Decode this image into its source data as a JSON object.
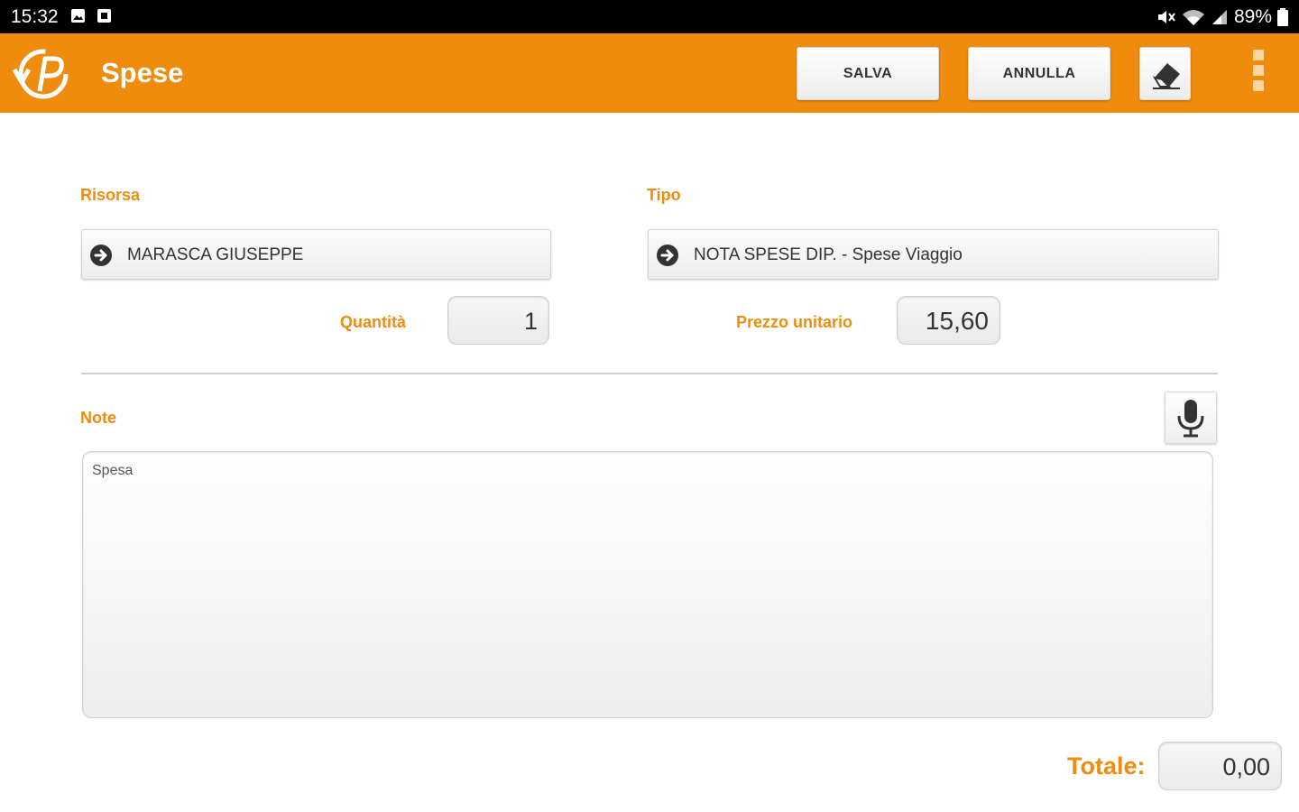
{
  "status_bar": {
    "time": "15:32",
    "battery": "89%"
  },
  "app_bar": {
    "title": "Spese",
    "save_label": "SALVA",
    "cancel_label": "ANNULLA",
    "accent_color": "#ef8c0e"
  },
  "form": {
    "risorsa_label": "Risorsa",
    "risorsa_value": "MARASCA GIUSEPPE",
    "tipo_label": "Tipo",
    "tipo_value": "NOTA SPESE DIP. - Spese Viaggio",
    "quantita_label": "Quantità",
    "quantita_value": "1",
    "prezzo_label": "Prezzo unitario",
    "prezzo_value": "15,60",
    "note_label": "Note",
    "note_value": "Spesa",
    "totale_label": "Totale:",
    "totale_value": "0,00"
  },
  "icons": {
    "logo": "app-logo-icon",
    "erase": "eraser-icon",
    "menu": "overflow-menu-icon",
    "picker_arrow": "arrow-right-circle-icon",
    "mic": "microphone-icon"
  }
}
